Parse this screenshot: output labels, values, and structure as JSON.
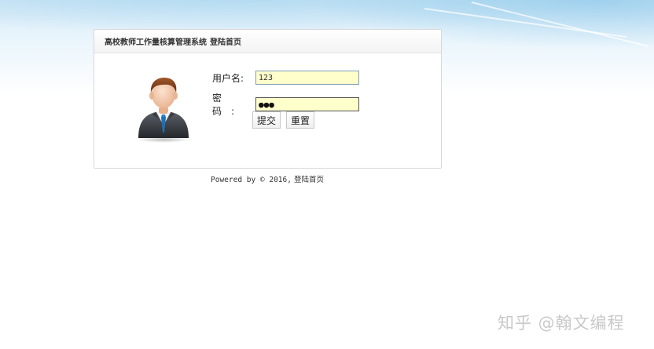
{
  "header": {
    "system_name": "高校教师工作量核算管理系统",
    "page_name": "登陆首页"
  },
  "form": {
    "username_label": "用户名:",
    "username_value": "123",
    "password_label": "密 码:",
    "password_mask": "●●●",
    "submit_label": "提交",
    "reset_label": "重置"
  },
  "footer": {
    "powered_text": "Powered by © 2016,",
    "page_name": "登陆首页"
  },
  "watermark": {
    "text": "知乎 @翰文编程"
  },
  "icons": {
    "avatar": "user-businessman-icon"
  },
  "colors": {
    "input_background": "#ffffcc",
    "panel_border": "#d8d8d8"
  }
}
